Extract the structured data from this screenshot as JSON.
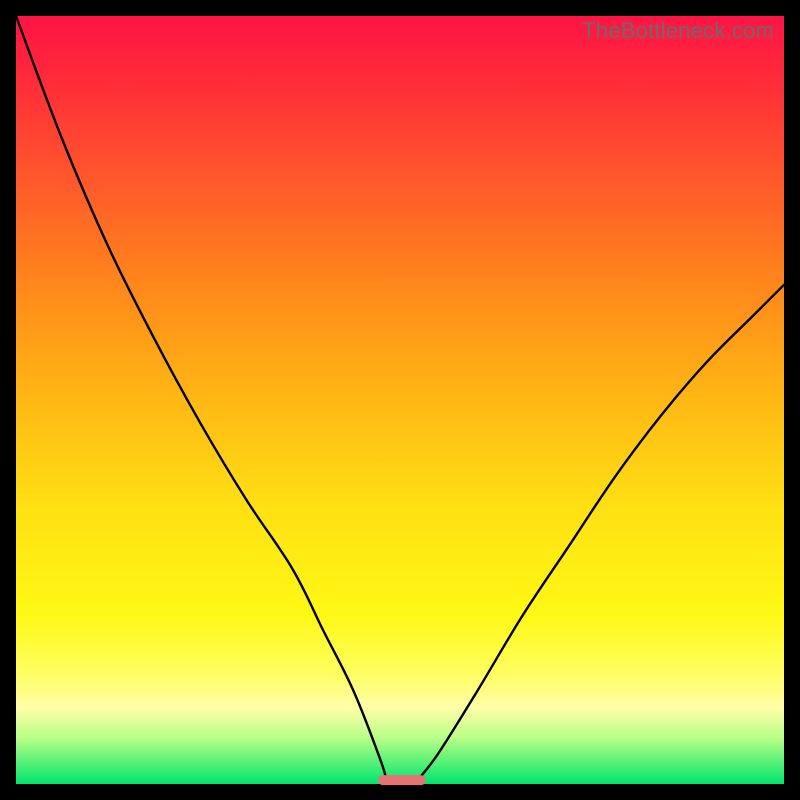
{
  "watermark": {
    "text": "TheBottleneck.com"
  },
  "chart_data": {
    "type": "line",
    "title": "",
    "xlabel": "",
    "ylabel": "",
    "xlim": [
      0,
      100
    ],
    "ylim": [
      0,
      100
    ],
    "series": [
      {
        "name": "curve-left",
        "x": [
          0,
          6,
          12,
          18,
          24,
          30,
          36,
          40,
          44,
          47.5,
          48.2
        ],
        "values": [
          100,
          84,
          70,
          58,
          47,
          37,
          28,
          20,
          12,
          3,
          0.5
        ]
      },
      {
        "name": "curve-right",
        "x": [
          52.3,
          55,
          60,
          66,
          72,
          78,
          84,
          90,
          96,
          100
        ],
        "values": [
          0.5,
          4,
          12,
          22,
          31,
          40,
          48,
          55,
          61,
          65
        ]
      }
    ],
    "marker": {
      "name": "minimum-marker",
      "x_center": 50.25,
      "width": 6.2,
      "y": 0.5,
      "color": "#e57373"
    },
    "gradient_stops": [
      {
        "pos": 0,
        "color": "#ff1444"
      },
      {
        "pos": 50,
        "color": "#ffe014"
      },
      {
        "pos": 90,
        "color": "#fffea8"
      },
      {
        "pos": 100,
        "color": "#00e46a"
      }
    ]
  }
}
